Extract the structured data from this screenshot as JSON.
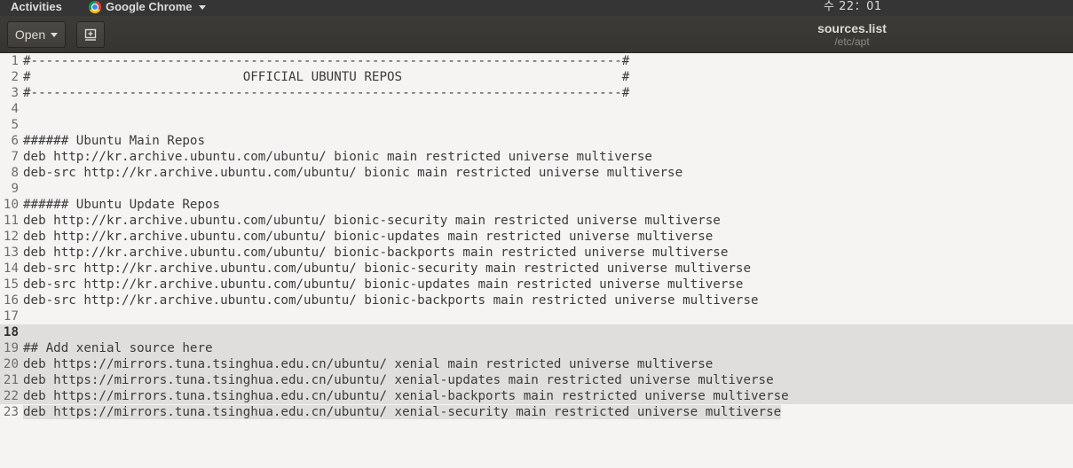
{
  "topbar": {
    "activities": "Activities",
    "app_name": "Google Chrome",
    "clock": "수 22：01"
  },
  "headerbar": {
    "open_label": "Open",
    "title": "sources.list",
    "subtitle": "/etc/apt"
  },
  "editor": {
    "current_line": 18,
    "lines": [
      {
        "n": "1",
        "text": "#------------------------------------------------------------------------------#"
      },
      {
        "n": "2",
        "text": "#                            OFFICIAL UBUNTU REPOS                             #"
      },
      {
        "n": "3",
        "text": "#------------------------------------------------------------------------------#"
      },
      {
        "n": "4",
        "text": ""
      },
      {
        "n": "5",
        "text": ""
      },
      {
        "n": "6",
        "text": "###### Ubuntu Main Repos"
      },
      {
        "n": "7",
        "text": "deb http://kr.archive.ubuntu.com/ubuntu/ bionic main restricted universe multiverse"
      },
      {
        "n": "8",
        "text": "deb-src http://kr.archive.ubuntu.com/ubuntu/ bionic main restricted universe multiverse"
      },
      {
        "n": "9",
        "text": ""
      },
      {
        "n": "10",
        "text": "###### Ubuntu Update Repos"
      },
      {
        "n": "11",
        "text": "deb http://kr.archive.ubuntu.com/ubuntu/ bionic-security main restricted universe multiverse"
      },
      {
        "n": "12",
        "text": "deb http://kr.archive.ubuntu.com/ubuntu/ bionic-updates main restricted universe multiverse"
      },
      {
        "n": "13",
        "text": "deb http://kr.archive.ubuntu.com/ubuntu/ bionic-backports main restricted universe multiverse"
      },
      {
        "n": "14",
        "text": "deb-src http://kr.archive.ubuntu.com/ubuntu/ bionic-security main restricted universe multiverse"
      },
      {
        "n": "15",
        "text": "deb-src http://kr.archive.ubuntu.com/ubuntu/ bionic-updates main restricted universe multiverse"
      },
      {
        "n": "16",
        "text": "deb-src http://kr.archive.ubuntu.com/ubuntu/ bionic-backports main restricted universe multiverse"
      },
      {
        "n": "17",
        "text": ""
      },
      {
        "n": "18",
        "text": ""
      },
      {
        "n": "19",
        "text": "## Add xenial source here"
      },
      {
        "n": "20",
        "text": "deb https://mirrors.tuna.tsinghua.edu.cn/ubuntu/ xenial main restricted universe multiverse"
      },
      {
        "n": "21",
        "text": "deb https://mirrors.tuna.tsinghua.edu.cn/ubuntu/ xenial-updates main restricted universe multiverse"
      },
      {
        "n": "22",
        "text": "deb https://mirrors.tuna.tsinghua.edu.cn/ubuntu/ xenial-backports main restricted universe multiverse"
      },
      {
        "n": "23",
        "text": "deb https://mirrors.tuna.tsinghua.edu.cn/ubuntu/ xenial-security main restricted universe multiverse"
      }
    ]
  },
  "colors": {
    "topbar_bg": "#353535",
    "headerbar_bg": "#3c3b37",
    "editor_bg": "#f5f4f3",
    "selection_bg": "#dfdedc"
  },
  "icons": {
    "app_icon": "chrome-icon",
    "open_menu": "chevron-down-icon",
    "new_document": "new-document-icon"
  }
}
